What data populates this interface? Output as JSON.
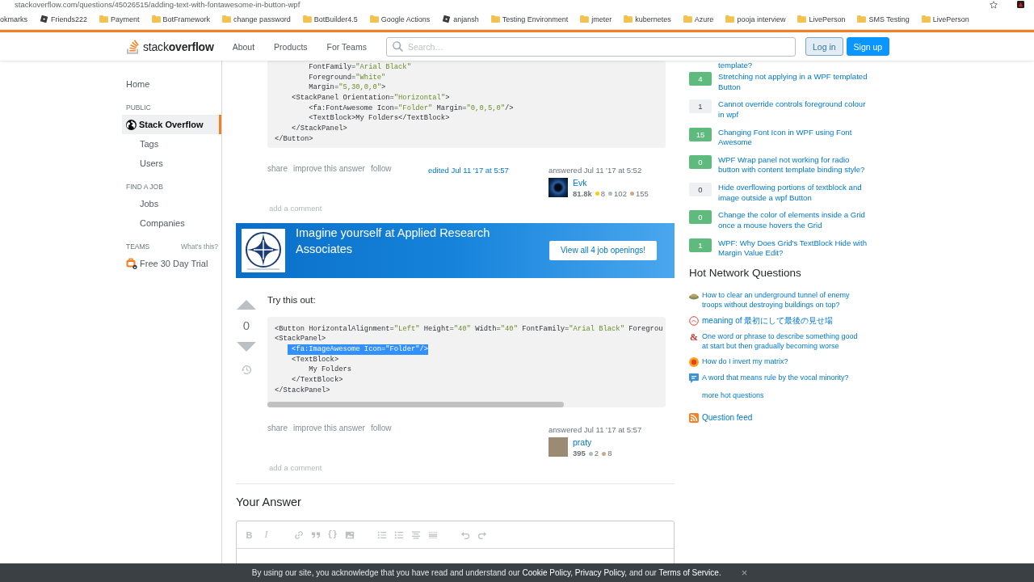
{
  "browser": {
    "address": "stackoverflow.com/questions/45026515/adding-text-with-fontawesome-in-button-wpf",
    "bookmarks": [
      {
        "kind": "plain",
        "label": "okmarks"
      },
      {
        "kind": "app",
        "label": "Friends222"
      },
      {
        "kind": "folder",
        "label": "Payment"
      },
      {
        "kind": "folder",
        "label": "BotFramework"
      },
      {
        "kind": "folder",
        "label": "change password"
      },
      {
        "kind": "folder",
        "label": "BotBuilder4.5"
      },
      {
        "kind": "folder",
        "label": "Google Actions"
      },
      {
        "kind": "app",
        "label": "anjansh"
      },
      {
        "kind": "folder",
        "label": "Testing Environment"
      },
      {
        "kind": "folder",
        "label": "jmeter"
      },
      {
        "kind": "folder",
        "label": "kubernetes"
      },
      {
        "kind": "folder",
        "label": "Azure"
      },
      {
        "kind": "folder",
        "label": "pooja interview"
      },
      {
        "kind": "folder",
        "label": "LivePerson"
      },
      {
        "kind": "folder",
        "label": "SMS Testing"
      },
      {
        "kind": "folder",
        "label": "LivePerson"
      }
    ]
  },
  "header": {
    "logo": "stack**overflow**",
    "nav": [
      "About",
      "Products",
      "For Teams"
    ],
    "search": {
      "placeholder": "Search…"
    },
    "buttons": [
      {
        "kind": "secondary",
        "label": "Log in"
      },
      {
        "kind": "primary",
        "label": "Sign up"
      }
    ]
  },
  "sidebar": {
    "items": [
      {
        "kind": "link",
        "label": "Home",
        "selected": false
      },
      {
        "kind": "heading",
        "label": "PUBLIC"
      },
      {
        "kind": "site",
        "label": "Stack Overflow",
        "selected": true
      },
      {
        "kind": "sublink",
        "label": "Tags",
        "selected": false
      },
      {
        "kind": "sublink",
        "label": "Users",
        "selected": false
      },
      {
        "kind": "heading",
        "label": "FIND A JOB"
      },
      {
        "kind": "sublink",
        "label": "Jobs",
        "selected": false
      },
      {
        "kind": "sublink",
        "label": "Companies",
        "selected": false
      },
      {
        "kind": "heading",
        "label": "TEAMS",
        "aside": "What's this?"
      },
      {
        "kind": "promo",
        "label": "Free 30 Day Trial",
        "selected": false
      }
    ]
  },
  "main": {
    "items": [
      {
        "kind": "answer",
        "code": {
          "scrollable": false,
          "lines": [
            {
              "text": "        FontFamily=\"Arial Black\"",
              "selected": false
            },
            {
              "text": "        Foreground=\"White\"",
              "selected": false
            },
            {
              "text": "        Margin=\"5,30,0,0\">",
              "selected": false
            },
            {
              "text": "    <StackPanel Orientation=\"Horizontal\">",
              "selected": false
            },
            {
              "text": "        <fa:FontAwesome Icon=\"Folder\" Margin=\"0,0,5,0\"/>",
              "selected": false
            },
            {
              "text": "        <TextBlock>My Folders</TextBlock>",
              "selected": false
            },
            {
              "text": "    </StackPanel>",
              "selected": false
            },
            {
              "text": "</Button>",
              "selected": false
            }
          ]
        },
        "menu": [
          "share",
          "improve this answer",
          "follow"
        ],
        "edited": "edited Jul 11 '17 at 5:57",
        "user": {
          "action": "answered Jul 11 '17 at 5:52",
          "avatar": {
            "kind": "image"
          },
          "name": "Evk",
          "reputation": "81.8k",
          "badges": [
            {
              "color": "#ffcc01",
              "count": "8"
            },
            {
              "color": "#b4b8bc",
              "count": "102"
            },
            {
              "color": "#d1a684",
              "count": "155"
            }
          ]
        },
        "comment_link": "add a comment"
      },
      {
        "kind": "ad",
        "headline": "Imagine yourself at Applied Research Associates",
        "button": "View all 4 job openings!"
      },
      {
        "kind": "answer",
        "votes": {
          "score": "0"
        },
        "body": "Try this out:",
        "code": {
          "scrollable": true,
          "lines": [
            {
              "text": "<Button HorizontalAlignment=\"Left\" Height=\"40\" Width=\"40\" FontFamily=\"Arial Black\" Foregrou",
              "selected": false
            },
            {
              "text": "<StackPanel>",
              "selected": false
            },
            {
              "text": "    <fa:ImageAwesome Icon=\"Folder\"/>",
              "selected": true
            },
            {
              "text": "    <TextBlock>",
              "selected": false
            },
            {
              "text": "        My Folders",
              "selected": false
            },
            {
              "text": "    </TextBlock>",
              "selected": false
            },
            {
              "text": "</StackPanel>",
              "selected": false
            }
          ]
        },
        "menu": [
          "share",
          "improve this answer",
          "follow"
        ],
        "user": {
          "action": "answered Jul 11 '17 at 5:57",
          "avatar": {
            "kind": "photo"
          },
          "name": "praty",
          "reputation": "395",
          "badges": [
            {
              "color": "#b4b8bc",
              "count": "2"
            },
            {
              "color": "#d1a684",
              "count": "8"
            }
          ]
        },
        "comment_link": "add a comment"
      }
    ],
    "your_answer": {
      "title": "Your Answer",
      "toolbar": [
        {
          "buttons": [
            {
              "kind": "bold",
              "label": "B"
            },
            {
              "kind": "italic",
              "label": "I"
            }
          ]
        },
        {
          "buttons": [
            {
              "kind": "link"
            },
            {
              "kind": "quote"
            },
            {
              "kind": "code",
              "label": "{}"
            },
            {
              "kind": "image"
            }
          ]
        },
        {
          "buttons": [
            {
              "kind": "olist"
            },
            {
              "kind": "ulist"
            },
            {
              "kind": "heading"
            },
            {
              "kind": "rule"
            }
          ]
        },
        {
          "buttons": [
            {
              "kind": "undo"
            },
            {
              "kind": "redo"
            }
          ]
        }
      ]
    }
  },
  "right": {
    "related": {
      "cut_text": "template?",
      "items": [
        {
          "count": "4",
          "answered": true,
          "title": "Stretching not applying in a WPF templated Button"
        },
        {
          "count": "1",
          "answered": false,
          "title": "Cannot override controls foreground colour in wpf"
        },
        {
          "count": "15",
          "answered": true,
          "title": "Changing Font Icon in WPF using Font Awesome"
        },
        {
          "count": "0",
          "answered": true,
          "title": "WPF Wrap panel not working for radio button with content template binding style?"
        },
        {
          "count": "0",
          "answered": false,
          "title": "Hide overflowing portions of textblock and image outside a wpf Button"
        },
        {
          "count": "0",
          "answered": true,
          "title": "Change the color of elements inside a Grid once a mouse hovers the Grid"
        },
        {
          "count": "1",
          "answered": true,
          "title": "WPF: Why Does Grid's TextBlock Hide with Margin Value Edit?"
        }
      ]
    },
    "hot": {
      "title": "Hot Network Questions",
      "items": [
        {
          "kind": "dome",
          "title": "How to clear an underground tunnel of enemy troops without destroying buildings on top?"
        },
        {
          "kind": "ring",
          "title": "meaning of 最初にして最後の見せ場"
        },
        {
          "kind": "glyph",
          "glyph": "&",
          "title": "One word or phrase to describe something good at start but then gradually becoming worse"
        },
        {
          "kind": "sun",
          "title": "How do I invert my matrix?"
        },
        {
          "kind": "bubble",
          "title": "A word that means rule by the vocal minority?"
        }
      ],
      "more": "more hot questions"
    },
    "feed": "Question feed"
  },
  "cookie_bar": {
    "segments": [
      {
        "kind": "text",
        "text": "By using our site, you acknowledge that you have read and understand our "
      },
      {
        "kind": "link",
        "text": "Cookie Policy"
      },
      {
        "kind": "text",
        "text": ", "
      },
      {
        "kind": "link",
        "text": "Privacy Policy"
      },
      {
        "kind": "text",
        "text": ", and our "
      },
      {
        "kind": "link",
        "text": "Terms of Service"
      },
      {
        "kind": "text",
        "text": "."
      }
    ],
    "close": "×"
  }
}
